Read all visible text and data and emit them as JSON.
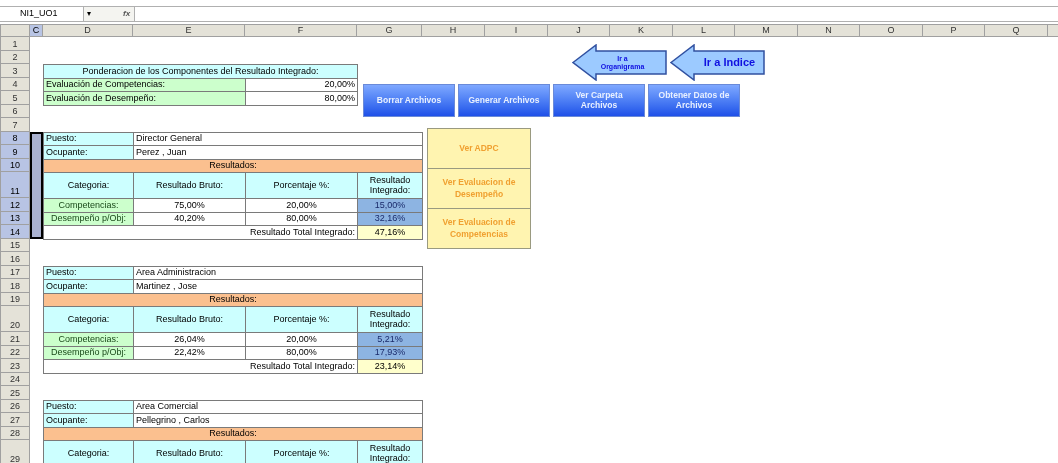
{
  "formula_bar": {
    "name_box": "NI1_UO1",
    "dropdown": "▾",
    "function_label": "fx"
  },
  "columns": [
    {
      "label": "C",
      "selected": true
    },
    {
      "label": "D",
      "selected": false
    },
    {
      "label": "E",
      "selected": false
    },
    {
      "label": "F",
      "selected": false
    },
    {
      "label": "G",
      "selected": false
    },
    {
      "label": "H",
      "selected": false
    },
    {
      "label": "I",
      "selected": false
    },
    {
      "label": "J",
      "selected": false
    },
    {
      "label": "K",
      "selected": false
    },
    {
      "label": "L",
      "selected": false
    },
    {
      "label": "M",
      "selected": false
    },
    {
      "label": "N",
      "selected": false
    },
    {
      "label": "O",
      "selected": false
    },
    {
      "label": "P",
      "selected": false
    },
    {
      "label": "Q",
      "selected": false
    }
  ],
  "rows": [
    {
      "label": "1",
      "selected": false
    },
    {
      "label": "2",
      "selected": false
    },
    {
      "label": "3",
      "selected": false
    },
    {
      "label": "4",
      "selected": false
    },
    {
      "label": "5",
      "selected": false
    },
    {
      "label": "6",
      "selected": false
    },
    {
      "label": "7",
      "selected": false
    },
    {
      "label": "8",
      "selected": true
    },
    {
      "label": "9",
      "selected": true
    },
    {
      "label": "10",
      "selected": true
    },
    {
      "label": "11",
      "selected": true
    },
    {
      "label": "12",
      "selected": true
    },
    {
      "label": "13",
      "selected": true
    },
    {
      "label": "14",
      "selected": true
    },
    {
      "label": "15",
      "selected": false
    },
    {
      "label": "16",
      "selected": false
    },
    {
      "label": "17",
      "selected": false
    },
    {
      "label": "18",
      "selected": false
    },
    {
      "label": "19",
      "selected": false
    },
    {
      "label": "20",
      "selected": false
    },
    {
      "label": "21",
      "selected": false
    },
    {
      "label": "22",
      "selected": false
    },
    {
      "label": "23",
      "selected": false
    },
    {
      "label": "24",
      "selected": false
    },
    {
      "label": "25",
      "selected": false
    },
    {
      "label": "26",
      "selected": false
    },
    {
      "label": "27",
      "selected": false
    },
    {
      "label": "28",
      "selected": false
    },
    {
      "label": "29",
      "selected": false
    }
  ],
  "weights": {
    "title": "Ponderacion de los Componentes del Resultado Integrado:",
    "items": [
      {
        "label": "Evaluación de Competencias:",
        "value": "20,00%"
      },
      {
        "label": "Evaluación de Desempeño:",
        "value": "80,00%"
      }
    ]
  },
  "nav_arrows": [
    "Ir a Organigrama",
    "Ir a Indice"
  ],
  "buttons": [
    "Borrar Archivos",
    "Generar Archivos",
    "Ver Carpeta Archivos",
    "Obtener Datos de Archivos"
  ],
  "side_buttons": [
    "Ver ADPC",
    "Ver Evaluacion de Desempeño",
    "Ver Evaluacion de Competencias"
  ],
  "employees": [
    {
      "puesto_label": "Puesto:",
      "puesto": "Director General",
      "ocupante_label": "Ocupante:",
      "ocupante": "Perez , Juan",
      "results_title": "Resultados:",
      "headers": [
        "Categoria:",
        "Resultado Bruto:",
        "Porcentaje %:",
        "Resultado Integrado:"
      ],
      "results": [
        {
          "category": "Competencias:",
          "bruto": "75,00%",
          "porcentaje": "20,00%",
          "integrado": "15,00%"
        },
        {
          "category": "Desempeño p/Obj:",
          "bruto": "40,20%",
          "porcentaje": "80,00%",
          "integrado": "32,16%"
        }
      ],
      "total_label": "Resultado Total Integrado:",
      "total": "47,16%"
    },
    {
      "puesto_label": "Puesto:",
      "puesto": "Area Administracion",
      "ocupante_label": "Ocupante:",
      "ocupante": "Martinez , Jose",
      "results_title": "Resultados:",
      "headers": [
        "Categoria:",
        "Resultado Bruto:",
        "Porcentaje %:",
        "Resultado Integrado:"
      ],
      "results": [
        {
          "category": "Competencias:",
          "bruto": "26,04%",
          "porcentaje": "20,00%",
          "integrado": "5,21%"
        },
        {
          "category": "Desempeño p/Obj:",
          "bruto": "22,42%",
          "porcentaje": "80,00%",
          "integrado": "17,93%"
        }
      ],
      "total_label": "Resultado Total Integrado:",
      "total": "23,14%"
    },
    {
      "puesto_label": "Puesto:",
      "puesto": "Area Comercial",
      "ocupante_label": "Ocupante:",
      "ocupante": "Pellegrino , Carlos",
      "results_title": "Resultados:",
      "headers": [
        "Categoria:",
        "Resultado Bruto:",
        "Porcentaje %:",
        "Resultado Integrado:"
      ]
    }
  ]
}
